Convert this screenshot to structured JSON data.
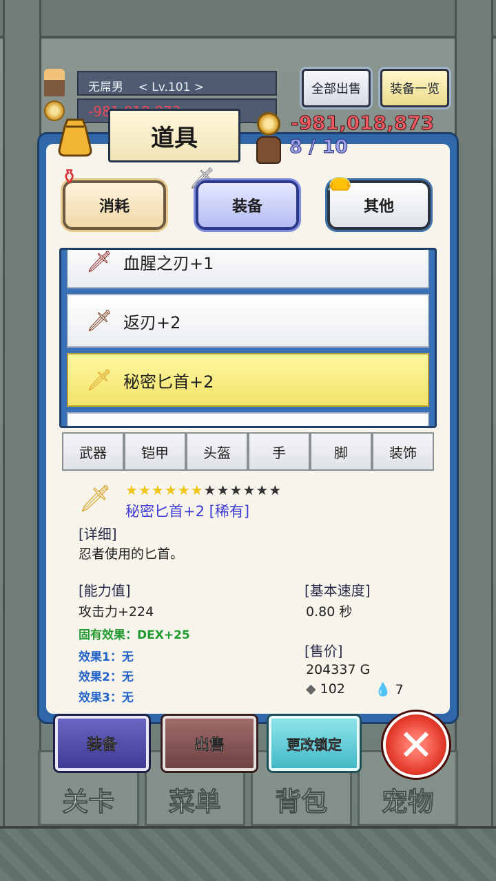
{
  "background": {
    "nav": [
      "关卡",
      "菜单",
      "背包",
      "宠物"
    ],
    "player_name": "无屌男",
    "player_level": "< Lv.101 >",
    "player_gold": "-981,018,873"
  },
  "header": {
    "sell_all": "全部出售",
    "equip_list": "装备一览",
    "title": "道具",
    "gold": "-981,018,873",
    "capacity": "8 / 10"
  },
  "categories": [
    "消耗",
    "装备",
    "其他"
  ],
  "items": [
    {
      "name": "血腥之刃+1",
      "selected": false
    },
    {
      "name": "返刃+2",
      "selected": false
    },
    {
      "name": "秘密匕首+2",
      "selected": true
    }
  ],
  "slot_tabs": [
    "武器",
    "铠甲",
    "头盔",
    "手",
    "脚",
    "装饰"
  ],
  "detail": {
    "stars_filled": 6,
    "stars_total": 12,
    "name": "秘密匕首+2 [稀有]",
    "desc_header": "[详细]",
    "desc": "忍者使用的匕首。",
    "stats_header": "[能力值]",
    "attack": "攻击力+224",
    "inherent": "固有效果：DEX+25",
    "effect1": "效果1：无",
    "effect2": "效果2：无",
    "effect3": "效果3：无",
    "speed_header": "[基本速度]",
    "speed": "0.80 秒",
    "price_header": "[售价]",
    "price": "204337 G",
    "ore": "102",
    "drop": "7"
  },
  "actions": {
    "equip": "装备",
    "sell": "出售",
    "lock": "更改锁定",
    "close_icon": "close-icon"
  },
  "colors": {
    "panel": "#2f67a8",
    "selected_row": "#f2e36a",
    "gold_text": "#f05a62",
    "rare_name": "#3c3ad6"
  }
}
